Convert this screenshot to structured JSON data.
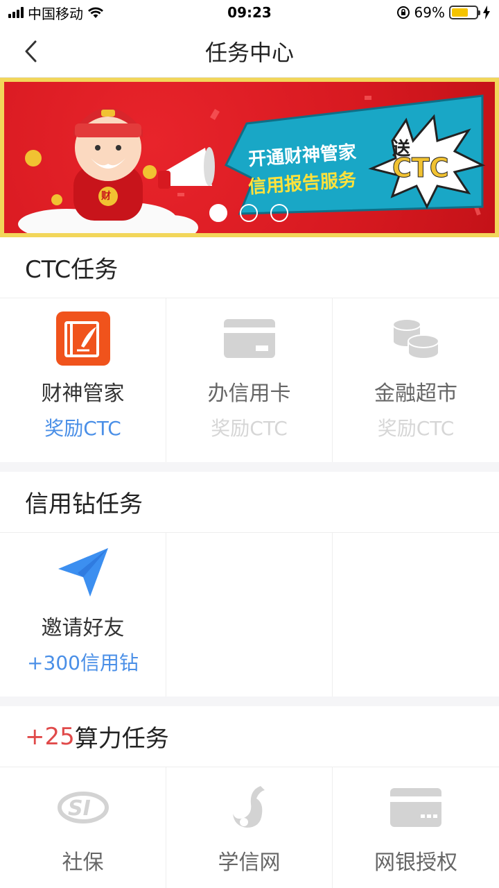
{
  "status_bar": {
    "carrier": "中国移动",
    "time": "09:23",
    "battery_percent": "69%",
    "battery_level": 0.69
  },
  "nav": {
    "title": "任务中心"
  },
  "banner": {
    "line1": "开通财神管家",
    "line2": "信用报告服务",
    "bubble_top": "送",
    "bubble_main": "CTC",
    "mascot_badge": "财",
    "active_index": 0,
    "slide_count": 3
  },
  "sections": {
    "ctc": {
      "title": "CTC任务",
      "items": [
        {
          "label": "财神管家",
          "reward": "奖励CTC",
          "active": true,
          "icon": "notebook-pen-icon"
        },
        {
          "label": "办信用卡",
          "reward": "奖励CTC",
          "active": false,
          "icon": "credit-card-icon"
        },
        {
          "label": "金融超市",
          "reward": "奖励CTC",
          "active": false,
          "icon": "coins-stack-icon"
        }
      ]
    },
    "diamond": {
      "title": "信用钻任务",
      "items": [
        {
          "label": "邀请好友",
          "reward": "+300信用钻",
          "active": true,
          "icon": "paper-plane-icon"
        }
      ]
    },
    "compute": {
      "title_prefix": "+25",
      "title_suffix": "算力任务",
      "items": [
        {
          "label": "社保",
          "icon": "social-security-si-icon"
        },
        {
          "label": "学信网",
          "icon": "flame-logo-icon"
        },
        {
          "label": "网银授权",
          "icon": "bank-card-icon"
        }
      ]
    }
  },
  "colors": {
    "accent_blue": "#4a8fe7",
    "accent_red": "#e04a4a",
    "banner_red": "#d71920",
    "banner_frame": "#f2d65a",
    "banner_cyan": "#19a7c6",
    "icon_orange": "#f0531c"
  }
}
